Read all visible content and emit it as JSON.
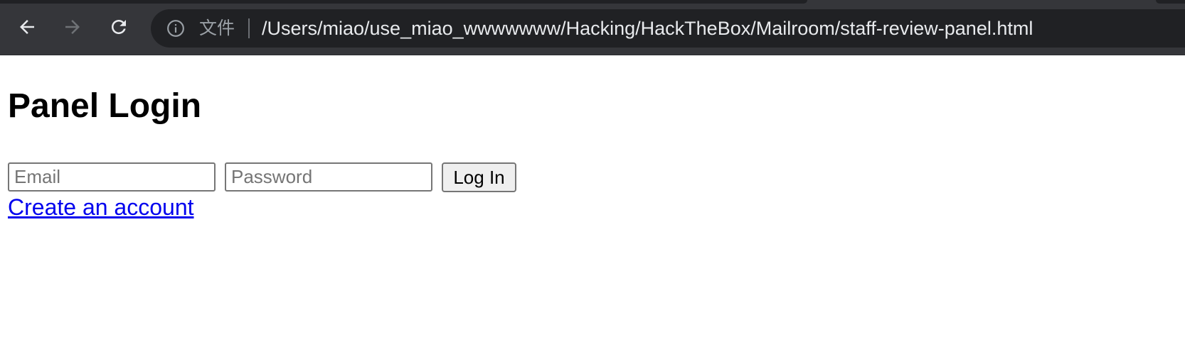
{
  "browser": {
    "nav": {
      "back_icon": "arrow-left-icon",
      "forward_icon": "arrow-right-icon",
      "reload_icon": "reload-icon"
    },
    "address_bar": {
      "info_icon": "info-icon",
      "scheme_label": "文件",
      "url": "/Users/miao/use_miao_wwwwwww/Hacking/HackTheBox/Mailroom/staff-review-panel.html"
    }
  },
  "page": {
    "title": "Panel Login",
    "form": {
      "email_placeholder": "Email",
      "email_value": "",
      "password_placeholder": "Password",
      "password_value": "",
      "submit_label": "Log In"
    },
    "create_account_link": "Create an account"
  },
  "colors": {
    "toolbar_bg": "#35363a",
    "omnibox_bg": "#202124",
    "link": "#0000ee"
  }
}
